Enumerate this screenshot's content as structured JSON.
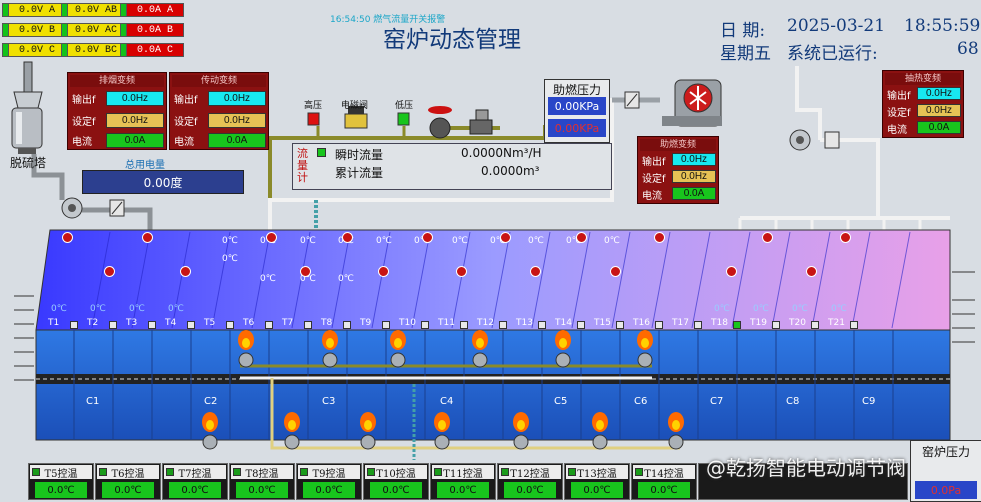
{
  "phase_indicators": [
    {
      "label": "0.0V A",
      "kind": "voltage"
    },
    {
      "label": "0.0V AB",
      "kind": "voltage"
    },
    {
      "label": "0.0A A",
      "kind": "current"
    },
    {
      "label": "0.0V B",
      "kind": "voltage"
    },
    {
      "label": "0.0V AC",
      "kind": "voltage"
    },
    {
      "label": "0.0A B",
      "kind": "current"
    },
    {
      "label": "0.0V C",
      "kind": "voltage"
    },
    {
      "label": "0.0V BC",
      "kind": "voltage"
    },
    {
      "label": "0.0A C",
      "kind": "current"
    }
  ],
  "header": {
    "small_time": "16:54:50 燃气流量开关报警",
    "title": "窑炉动态管理",
    "date_label": "日 期:",
    "date_value": "2025-03-21",
    "time_value": "18:55:59",
    "weekday_label": "星期五",
    "runtime_label": "系统已运行:",
    "runtime_value": "68"
  },
  "desulfur_tower": {
    "label": "脱硫塔"
  },
  "fan_vfd_1": {
    "title": "排烟变频",
    "rows": [
      {
        "label": "输出f",
        "value": "0.0Hz"
      },
      {
        "label": "设定f",
        "value": "0.0Hz"
      },
      {
        "label": "电流",
        "value": "0.0A"
      }
    ]
  },
  "fan_vfd_2": {
    "title": "传动变频",
    "rows": [
      {
        "label": "输出f",
        "value": "0.0Hz"
      },
      {
        "label": "设定f",
        "value": "0.0Hz"
      },
      {
        "label": "电流",
        "value": "0.0A"
      }
    ]
  },
  "total_power": {
    "label": "总用电量",
    "value": "0.00度"
  },
  "gas_devices": {
    "high": "高压",
    "valve": "电磁阀",
    "low": "低压"
  },
  "flow_meter": {
    "side_label": "流量计",
    "instant_label": "瞬时流量",
    "instant_value": "0.0000Nm³/H",
    "total_label": "累计流量",
    "total_value": "0.0000m³"
  },
  "aux_pressure": {
    "title": "助燃压力",
    "value1": "0.00KPa",
    "value2": "0.00KPa"
  },
  "aux_vfd": {
    "title": "助燃变频",
    "rows": [
      {
        "label": "输出f",
        "value": "0.0Hz"
      },
      {
        "label": "设定f",
        "value": "0.0Hz"
      },
      {
        "label": "电流",
        "value": "0.0A"
      }
    ]
  },
  "cool_vfd": {
    "title": "抽热变频",
    "rows": [
      {
        "label": "输出f",
        "value": "0.0Hz"
      },
      {
        "label": "设定f",
        "value": "0.0Hz"
      },
      {
        "label": "电流",
        "value": "0.0A"
      }
    ]
  },
  "kiln": {
    "zone_labels": [
      "T1",
      "T2",
      "T3",
      "T4",
      "T5",
      "T6",
      "T7",
      "T8",
      "T9",
      "T10",
      "T11",
      "T12",
      "T13",
      "T14",
      "T15",
      "T16",
      "T17",
      "T18",
      "T19",
      "T20",
      "T21"
    ],
    "zone_temps": [
      "0℃",
      "0℃",
      "0℃",
      "0℃",
      "",
      "",
      "",
      "",
      "",
      "",
      "",
      "",
      "",
      "",
      "",
      "",
      "",
      "0℃",
      "0℃",
      "0℃",
      "0℃"
    ],
    "upper_temps": [
      "0℃",
      "0℃",
      "0℃",
      "0℃",
      "0℃",
      "0℃",
      "0℃",
      "0℃",
      "0℃",
      "0℃",
      "0℃",
      "0℃",
      "0℃",
      "0℃",
      "0℃"
    ],
    "car_labels": [
      "C1",
      "C2",
      "C3",
      "C4",
      "C5",
      "C6",
      "C7",
      "C8",
      "C9"
    ]
  },
  "kiln_pressure": {
    "title": "窑炉压力",
    "value": "0.0Pa"
  },
  "bottom_controls": [
    {
      "label": "T5控温",
      "value": "0.0℃"
    },
    {
      "label": "T6控温",
      "value": "0.0℃"
    },
    {
      "label": "T7控温",
      "value": "0.0℃"
    },
    {
      "label": "T8控温",
      "value": "0.0℃"
    },
    {
      "label": "T9控温",
      "value": "0.0℃"
    },
    {
      "label": "T10控温",
      "value": "0.0℃"
    },
    {
      "label": "T11控温",
      "value": "0.0℃"
    },
    {
      "label": "T12控温",
      "value": "0.0℃"
    },
    {
      "label": "T13控温",
      "value": "0.0℃"
    },
    {
      "label": "T14控温",
      "value": "0.0℃"
    }
  ],
  "watermark": "@乾扬智能电动调节阀"
}
